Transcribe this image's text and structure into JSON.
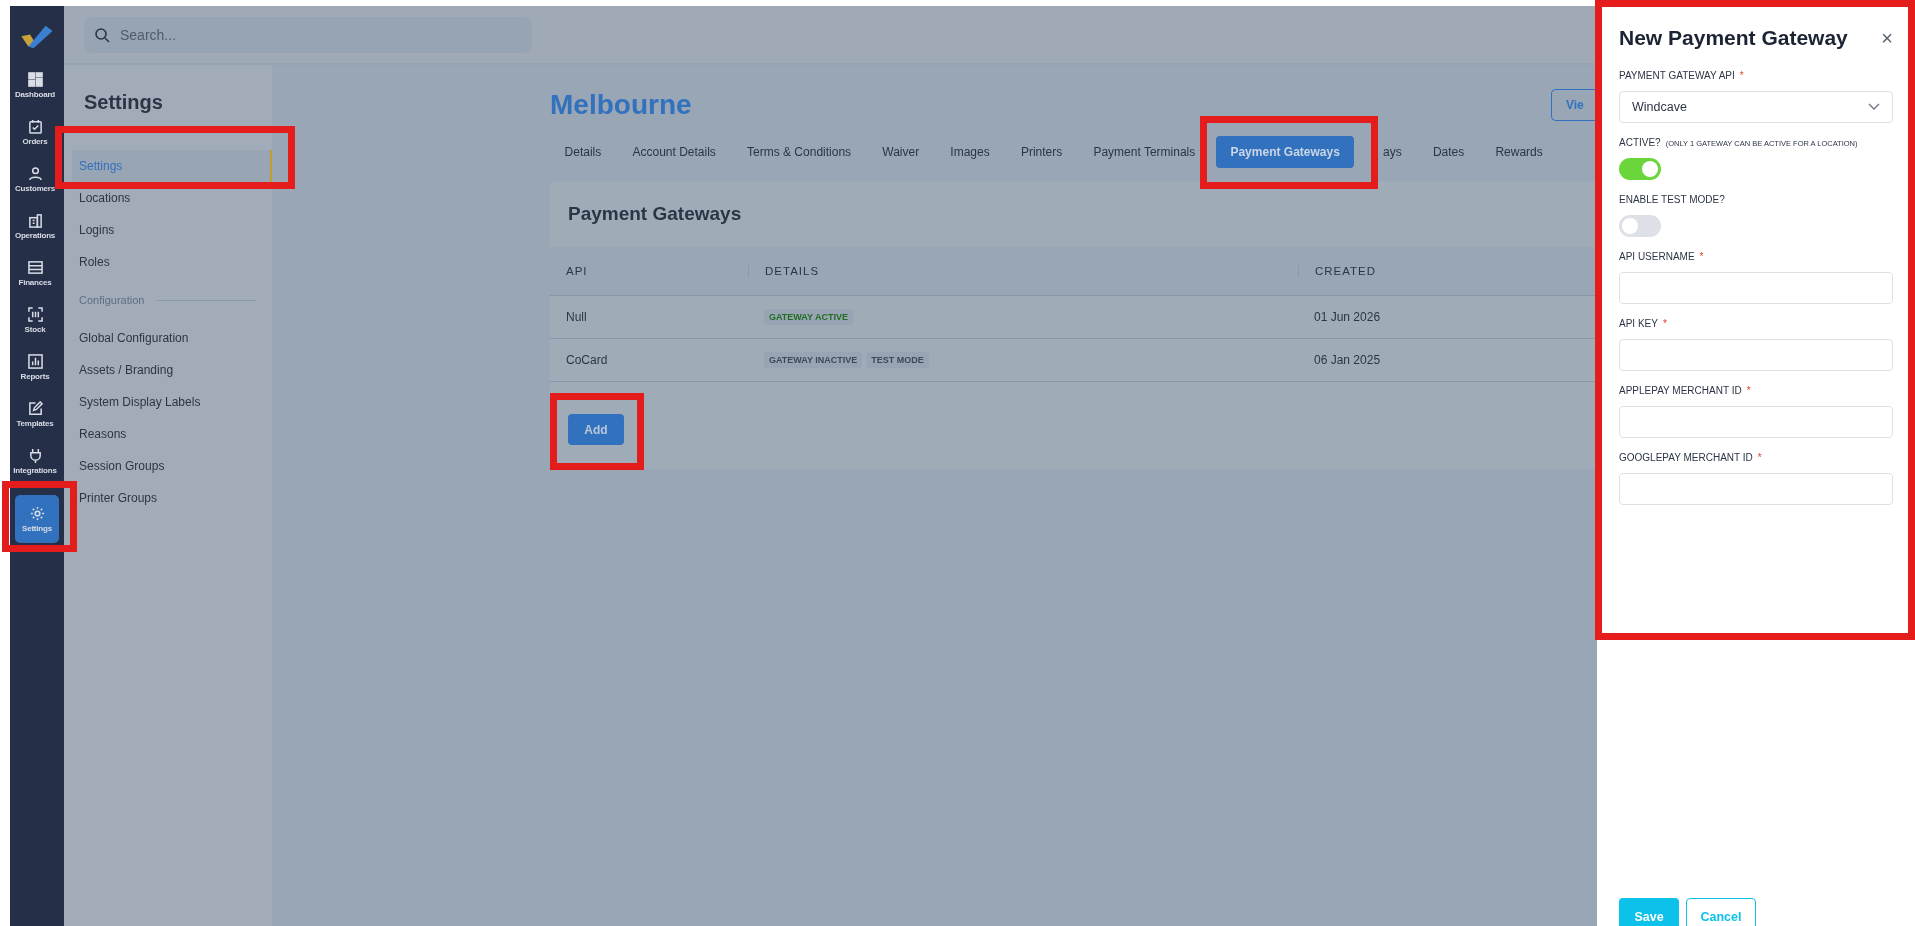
{
  "nav": [
    {
      "label": "Dashboard",
      "selected": false
    },
    {
      "label": "Orders",
      "selected": false
    },
    {
      "label": "Customers",
      "selected": false
    },
    {
      "label": "Operations",
      "selected": false
    },
    {
      "label": "Finances",
      "selected": false
    },
    {
      "label": "Stock",
      "selected": false
    },
    {
      "label": "Reports",
      "selected": false
    },
    {
      "label": "Templates",
      "selected": false
    },
    {
      "label": "Integrations",
      "selected": false
    },
    {
      "label": "Settings",
      "selected": true
    }
  ],
  "search": {
    "placeholder": "Search..."
  },
  "settings_menu": {
    "title": "Settings",
    "items": [
      {
        "kind": "item",
        "label": "Settings",
        "selected": true
      },
      {
        "kind": "item",
        "label": "Locations",
        "selected": false
      },
      {
        "kind": "item",
        "label": "Logins",
        "selected": false
      },
      {
        "kind": "item",
        "label": "Roles",
        "selected": false
      },
      {
        "kind": "heading",
        "label": "Configuration"
      },
      {
        "kind": "item",
        "label": "Global Configuration",
        "selected": false
      },
      {
        "kind": "item",
        "label": "Assets / Branding",
        "selected": false
      },
      {
        "kind": "item",
        "label": "System Display Labels",
        "selected": false
      },
      {
        "kind": "item",
        "label": "Reasons",
        "selected": false
      },
      {
        "kind": "item",
        "label": "Session Groups",
        "selected": false
      },
      {
        "kind": "item",
        "label": "Printer Groups",
        "selected": false
      }
    ]
  },
  "location": {
    "title": "Melbourne",
    "view_button": "Vie"
  },
  "tabs": [
    {
      "label": "Details",
      "selected": false
    },
    {
      "label": "Account Details",
      "selected": false
    },
    {
      "label": "Terms & Conditions",
      "selected": false
    },
    {
      "label": "Waiver",
      "selected": false
    },
    {
      "label": "Images",
      "selected": false
    },
    {
      "label": "Printers",
      "selected": false
    },
    {
      "label": "Payment Terminals",
      "selected": false
    },
    {
      "label": "Payment Gateways",
      "selected": true
    },
    {
      "label": "ays",
      "selected": false
    },
    {
      "label": "Dates",
      "selected": false
    },
    {
      "label": "Rewards",
      "selected": false
    }
  ],
  "card": {
    "title": "Payment Gateways",
    "columns": [
      "API",
      "DETAILS",
      "CREATED"
    ],
    "rows": [
      {
        "api": "Null",
        "tags": [
          {
            "label": "GATEWAY ACTIVE",
            "kind": "active"
          }
        ],
        "created": "01 Jun 2026"
      },
      {
        "api": "CoCard",
        "tags": [
          {
            "label": "GATEWAY INACTIVE",
            "kind": "inactive"
          },
          {
            "label": "TEST MODE",
            "kind": "inactive"
          }
        ],
        "created": "06 Jan 2025"
      }
    ],
    "add_button": "Add"
  },
  "panel": {
    "title": "New Payment Gateway",
    "close": "×",
    "fields": [
      {
        "kind": "select",
        "label": "PAYMENT GATEWAY API",
        "required_mark": "*",
        "value": "Windcave"
      },
      {
        "kind": "toggle",
        "label": "ACTIVE?",
        "note": "(ONLY 1 GATEWAY CAN BE ACTIVE FOR A LOCATION)",
        "on": true
      },
      {
        "kind": "toggle",
        "label": "ENABLE TEST MODE?",
        "on": false
      },
      {
        "kind": "text",
        "label": "API USERNAME",
        "required_mark": "*"
      },
      {
        "kind": "text",
        "label": "API KEY",
        "required_mark": "*"
      },
      {
        "kind": "text",
        "label": "APPLEPAY MERCHANT ID",
        "required_mark": "*"
      },
      {
        "kind": "text",
        "label": "GOOGLEPAY MERCHANT ID",
        "required_mark": "*"
      }
    ],
    "save": "Save",
    "cancel": "Cancel"
  }
}
